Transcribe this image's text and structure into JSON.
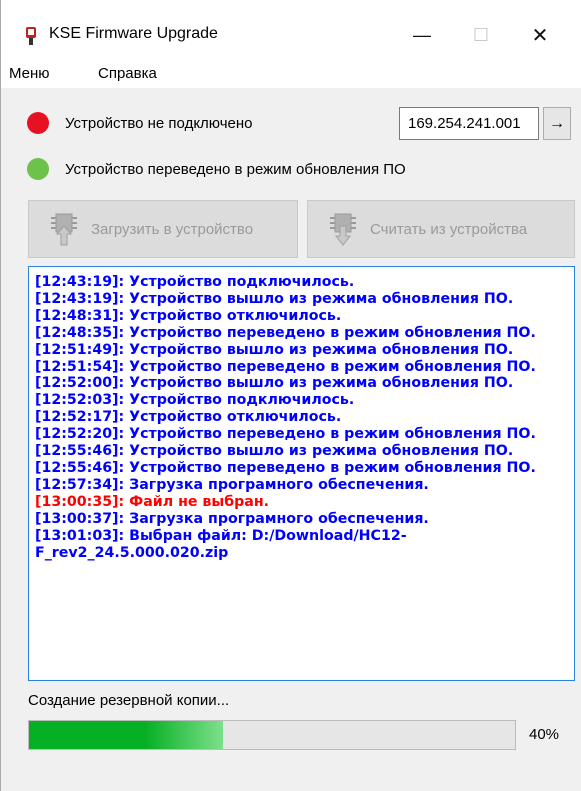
{
  "window": {
    "title": "KSE Firmware Upgrade",
    "minimize_glyph": "—",
    "maximize_glyph": "☐",
    "close_glyph": "✕"
  },
  "menu": {
    "items": [
      "Меню",
      "Справка"
    ]
  },
  "connection": {
    "status_text": "Устройство не подключено",
    "status_color": "#e81123",
    "ip_value": "169.254.241.001",
    "go_glyph": "→"
  },
  "mode": {
    "status_text": "Устройство переведено в режим обновления ПО",
    "status_color": "#6cc24a"
  },
  "actions": {
    "upload_label": "Загрузить в устройство",
    "upload_icon": "chip-upload-icon",
    "download_label": "Считать из устройства",
    "download_icon": "chip-download-icon"
  },
  "log": {
    "lines": [
      {
        "text": "[12:43:19]: Устройство подключилось.",
        "color": "#0000ff"
      },
      {
        "text": "[12:43:19]: Устройство вышло из режима обновления ПО.",
        "color": "#0000ff"
      },
      {
        "text": "[12:48:31]: Устройство отключилось.",
        "color": "#0000ff"
      },
      {
        "text": "[12:48:35]: Устройство переведено в режим обновления ПО.",
        "color": "#0000ff"
      },
      {
        "text": "[12:51:49]: Устройство вышло из режима обновления ПО.",
        "color": "#0000ff"
      },
      {
        "text": "[12:51:54]: Устройство переведено в режим обновления ПО.",
        "color": "#0000ff"
      },
      {
        "text": "[12:52:00]: Устройство вышло из режима обновления ПО.",
        "color": "#0000ff"
      },
      {
        "text": "[12:52:03]: Устройство подключилось.",
        "color": "#0000ff"
      },
      {
        "text": "[12:52:17]: Устройство отключилось.",
        "color": "#0000ff"
      },
      {
        "text": "[12:52:20]: Устройство переведено в режим обновления ПО.",
        "color": "#0000ff"
      },
      {
        "text": "[12:55:46]: Устройство вышло из режима обновления ПО.",
        "color": "#0000ff"
      },
      {
        "text": "[12:55:46]: Устройство переведено в режим обновления ПО.",
        "color": "#0000ff"
      },
      {
        "text": "[12:57:34]: Загрузка програмного обеспечения.",
        "color": "#0000ff"
      },
      {
        "text": "[13:00:35]: Файл не выбран.",
        "color": "#ff0000"
      },
      {
        "text": "[13:00:37]: Загрузка програмного обеспечения.",
        "color": "#0000ff"
      },
      {
        "text": "[13:01:03]: Выбран файл: D:/Download/HC12-\nF_rev2_24.5.000.020.zip",
        "color": "#0000ff"
      }
    ]
  },
  "progress": {
    "label": "Создание резервной копии...",
    "percent": 40,
    "percent_text": "40%",
    "fill_color": "#06b025"
  }
}
